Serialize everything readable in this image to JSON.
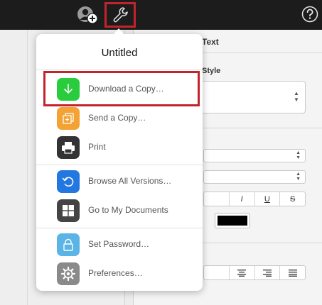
{
  "toolbar": {
    "collaborate_icon": "add-person-icon",
    "tools_icon": "wrench-icon",
    "help_icon": "question-circle-icon",
    "highlight_color": "#c3232b"
  },
  "inspector": {
    "tab_label": "Text",
    "style_label": "Style",
    "format_buttons": [
      "I",
      "U",
      "S"
    ],
    "text_color": "#000000"
  },
  "popover": {
    "title": "Untitled",
    "items": [
      {
        "label": "Download a Copy…",
        "icon": "download-icon",
        "color": "#28cc3c"
      },
      {
        "label": "Send a Copy…",
        "icon": "send-copy-icon",
        "color": "#f3a233"
      },
      {
        "label": "Print",
        "icon": "print-icon",
        "color": "#333333"
      },
      {
        "label": "Browse All Versions…",
        "icon": "versions-icon",
        "color": "#2278e0"
      },
      {
        "label": "Go to My Documents",
        "icon": "documents-grid-icon",
        "color": "#444444"
      },
      {
        "label": "Set Password…",
        "icon": "lock-icon",
        "color": "#5ab4e5"
      },
      {
        "label": "Preferences…",
        "icon": "gear-icon",
        "color": "#8a8a8a"
      }
    ]
  }
}
